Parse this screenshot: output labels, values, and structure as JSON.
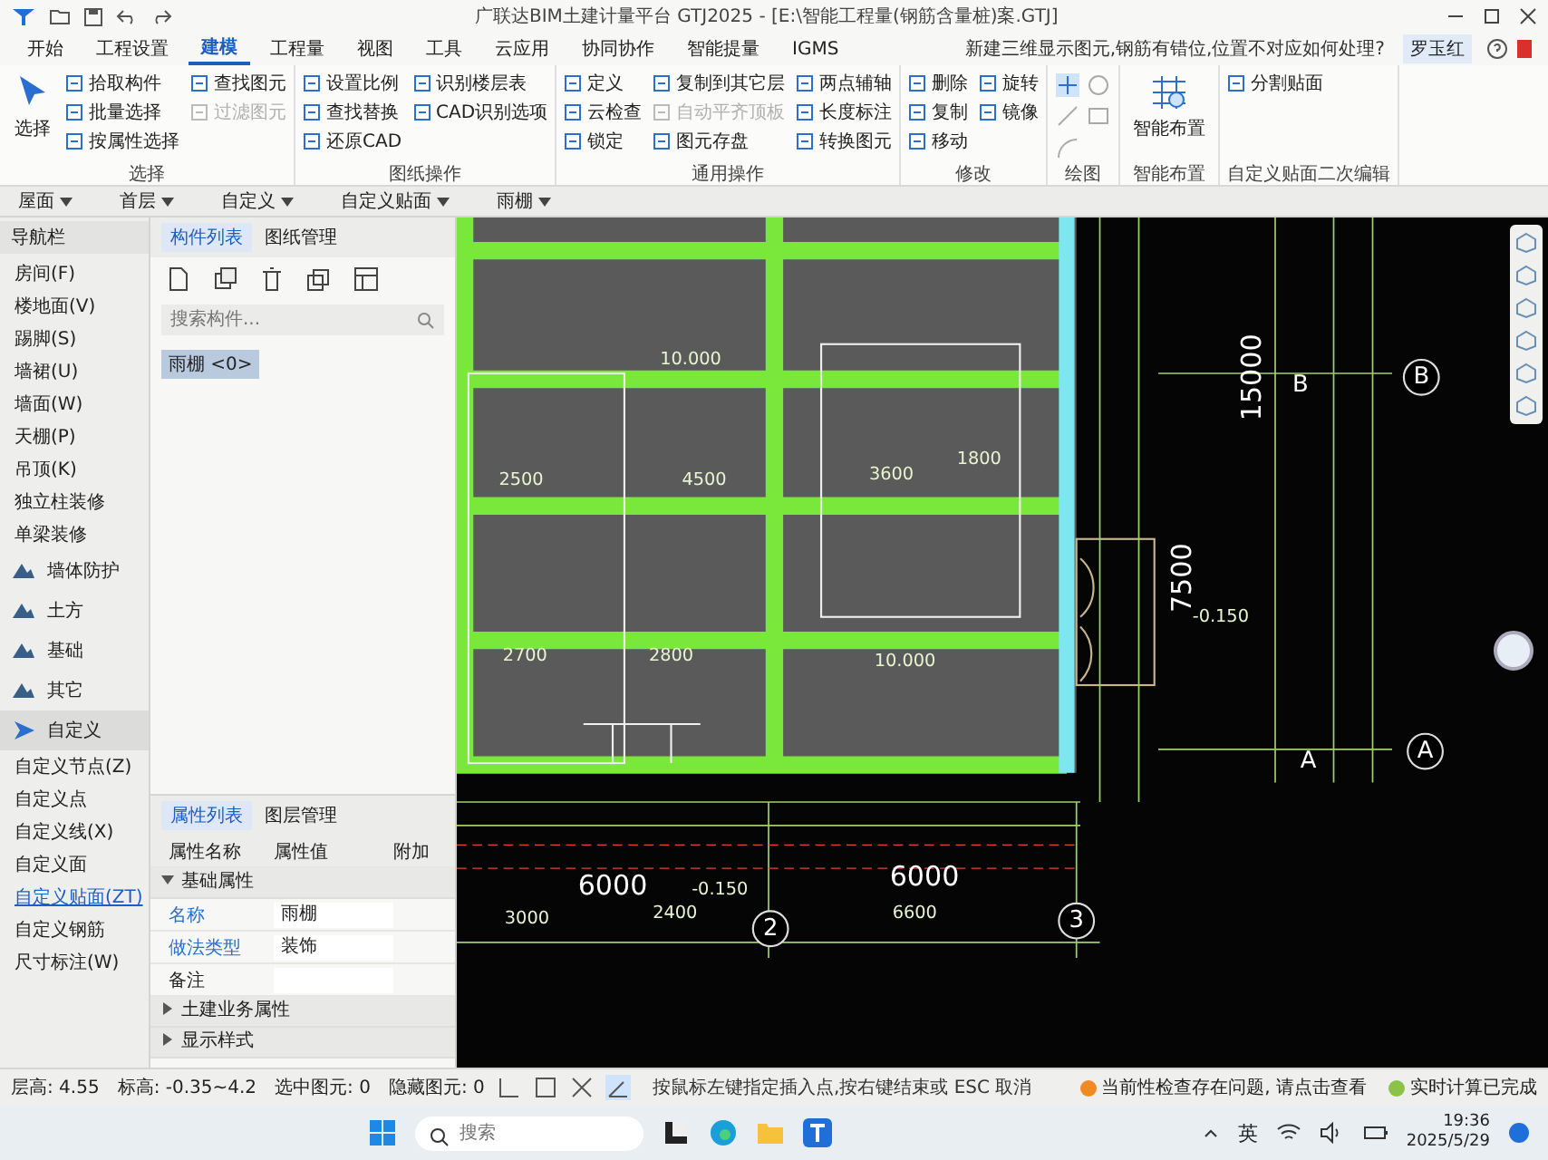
{
  "window": {
    "title": "广联达BIM土建计量平台 GTJ2025 - [E:\\智能工程量(钢筋含量桩)案.GTJ]"
  },
  "menu_tabs": [
    {
      "label": "开始",
      "selected": false
    },
    {
      "label": "工程设置",
      "selected": false
    },
    {
      "label": "建模",
      "selected": true
    },
    {
      "label": "工程量",
      "selected": false
    },
    {
      "label": "视图",
      "selected": false
    },
    {
      "label": "工具",
      "selected": false
    },
    {
      "label": "云应用",
      "selected": false
    },
    {
      "label": "协同协作",
      "selected": false
    },
    {
      "label": "智能提量",
      "selected": false
    },
    {
      "label": "IGMS",
      "selected": false
    }
  ],
  "help_question": "新建三维显示图元,钢筋有错位,位置不对应如何处理?",
  "user": "罗玉红",
  "ribbon": [
    {
      "label": "选择",
      "kind": "tools",
      "large": "选择",
      "items": [
        {
          "label": "拾取构件",
          "disabled": false
        },
        {
          "label": "批量选择",
          "disabled": false
        },
        {
          "label": "按属性选择",
          "disabled": false
        },
        {
          "label": "查找图元",
          "disabled": false
        },
        {
          "label": "过滤图元",
          "disabled": true
        }
      ]
    },
    {
      "label": "图纸操作",
      "kind": "tools",
      "items": [
        {
          "label": "设置比例",
          "disabled": false
        },
        {
          "label": "查找替换",
          "disabled": false
        },
        {
          "label": "还原CAD",
          "disabled": false
        },
        {
          "label": "识别楼层表",
          "disabled": false
        },
        {
          "label": "CAD识别选项",
          "disabled": false
        }
      ]
    },
    {
      "label": "通用操作",
      "kind": "tools",
      "items": [
        {
          "label": "定义",
          "disabled": false
        },
        {
          "label": "云检查",
          "disabled": false
        },
        {
          "label": "锁定",
          "disabled": false
        },
        {
          "label": "复制到其它层",
          "disabled": false
        },
        {
          "label": "自动平齐顶板",
          "disabled": true
        },
        {
          "label": "图元存盘",
          "disabled": false
        },
        {
          "label": "两点辅轴",
          "disabled": false
        },
        {
          "label": "长度标注",
          "disabled": false
        },
        {
          "label": "转换图元",
          "disabled": false
        }
      ]
    },
    {
      "label": "修改",
      "kind": "tools",
      "items": [
        {
          "label": "删除",
          "disabled": false
        },
        {
          "label": "复制",
          "disabled": false
        },
        {
          "label": "移动",
          "disabled": false
        },
        {
          "label": "旋转",
          "disabled": false
        },
        {
          "label": "镜像",
          "disabled": false
        }
      ]
    },
    {
      "label": "绘图",
      "kind": "icons"
    },
    {
      "label": "智能布置",
      "kind": "tools",
      "large": "智能布置"
    },
    {
      "label": "自定义贴面二次编辑",
      "kind": "tools",
      "items": [
        {
          "label": "分割贴面",
          "disabled": false
        }
      ]
    }
  ],
  "selectors": [
    "屋面",
    "首层",
    "自定义",
    "自定义贴面",
    "雨棚"
  ],
  "nav": {
    "title": "导航栏",
    "items": [
      {
        "label": "房间(F)",
        "kind": "item",
        "selected": false
      },
      {
        "label": "楼地面(V)",
        "kind": "item",
        "selected": false
      },
      {
        "label": "踢脚(S)",
        "kind": "item",
        "selected": false
      },
      {
        "label": "墙裙(U)",
        "kind": "item",
        "selected": false
      },
      {
        "label": "墙面(W)",
        "kind": "item",
        "selected": false
      },
      {
        "label": "天棚(P)",
        "kind": "item",
        "selected": false
      },
      {
        "label": "吊顶(K)",
        "kind": "item",
        "selected": false
      },
      {
        "label": "独立柱装修",
        "kind": "item",
        "selected": false
      },
      {
        "label": "单梁装修",
        "kind": "item",
        "selected": false
      },
      {
        "label": "墙体防护",
        "kind": "category",
        "selected": false
      },
      {
        "label": "土方",
        "kind": "category",
        "selected": false
      },
      {
        "label": "基础",
        "kind": "category",
        "selected": false
      },
      {
        "label": "其它",
        "kind": "category",
        "selected": false
      },
      {
        "label": "自定义",
        "kind": "category",
        "selected": true
      },
      {
        "label": "自定义节点(Z)",
        "kind": "item",
        "selected": false
      },
      {
        "label": "自定义点",
        "kind": "item",
        "selected": false
      },
      {
        "label": "自定义线(X)",
        "kind": "item",
        "selected": false
      },
      {
        "label": "自定义面",
        "kind": "item",
        "selected": false
      },
      {
        "label": "自定义贴面(ZT)",
        "kind": "item",
        "selected": true
      },
      {
        "label": "自定义钢筋",
        "kind": "item",
        "selected": false
      },
      {
        "label": "尺寸标注(W)",
        "kind": "item",
        "selected": false
      }
    ]
  },
  "component_panel": {
    "tabs": [
      {
        "label": "构件列表",
        "selected": true
      },
      {
        "label": "图纸管理",
        "selected": false
      }
    ],
    "search": {
      "placeholder": "搜索构件..."
    },
    "components": [
      {
        "label": "雨棚 <0>",
        "selected": true
      }
    ]
  },
  "property_panel": {
    "tabs": [
      {
        "label": "属性列表",
        "selected": true
      },
      {
        "label": "图层管理",
        "selected": false
      }
    ],
    "columns": [
      "属性名称",
      "属性值",
      "附加"
    ],
    "groups": [
      {
        "label": "基础属性",
        "expanded": true,
        "rows": [
          {
            "name": "名称",
            "value": "雨棚",
            "public": true
          },
          {
            "name": "做法类型",
            "value": "装饰",
            "public": true
          },
          {
            "name": "备注",
            "public": false
          }
        ]
      },
      {
        "label": "土建业务属性",
        "expanded": false
      },
      {
        "label": "显示样式",
        "expanded": false
      }
    ]
  },
  "canvas": {
    "labels": [
      {
        "text": "10.000",
        "kind": "dim"
      },
      {
        "text": "2500",
        "kind": "dim"
      },
      {
        "text": "4500",
        "kind": "dim"
      },
      {
        "text": "3600",
        "kind": "dim"
      },
      {
        "text": "1800",
        "kind": "dim"
      },
      {
        "text": "2700",
        "kind": "dim"
      },
      {
        "text": "2800",
        "kind": "dim"
      },
      {
        "text": "10.000",
        "kind": "dim"
      },
      {
        "text": "7500",
        "kind": "big"
      },
      {
        "text": "-0.150",
        "kind": "dim"
      },
      {
        "text": "15000",
        "kind": "big"
      },
      {
        "text": "B",
        "kind": "axis"
      },
      {
        "text": "B",
        "kind": "bubble"
      },
      {
        "text": "A",
        "kind": "axis"
      },
      {
        "text": "A",
        "kind": "bubble"
      },
      {
        "text": "6000",
        "kind": "big"
      },
      {
        "text": "-0.150",
        "kind": "dim"
      },
      {
        "text": "6000",
        "kind": "big"
      },
      {
        "text": "3000",
        "kind": "dim"
      },
      {
        "text": "2400",
        "kind": "dim"
      },
      {
        "text": "6600",
        "kind": "dim"
      },
      {
        "text": "2",
        "kind": "bubble"
      },
      {
        "text": "3",
        "kind": "bubble"
      }
    ]
  },
  "command_prompt": "按鼠标左键指定插入点,按右键结束或 ESC 取消",
  "notices": [
    {
      "text": "当前性检查存在问题, 请点击查看",
      "color": "#f08a24"
    },
    {
      "text": "实时计算已完成",
      "color": "#8bc34a"
    }
  ],
  "status_bar": [
    "层高: 4.55",
    "标高: -0.35~4.2",
    "选中图元: 0",
    "隐藏图元: 0"
  ],
  "taskbar": {
    "search": {
      "placeholder": "搜索"
    },
    "ime": "英",
    "time": "19:36",
    "date": "2025/5/29"
  }
}
